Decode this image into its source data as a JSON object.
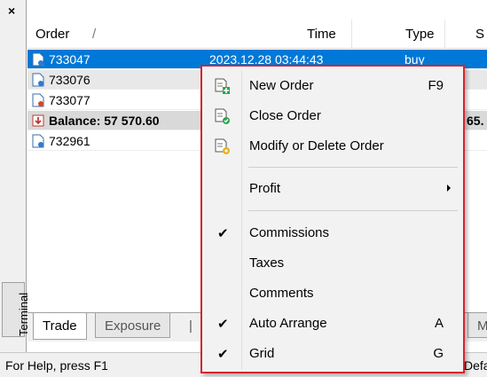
{
  "panel": {
    "close_glyph": "×",
    "vertical_label": "Terminal"
  },
  "table": {
    "columns": [
      "Order",
      "/",
      "Time",
      "Type",
      "S"
    ],
    "rows": [
      {
        "order": "733047",
        "time": "2023.12.28 03:44:43",
        "type": "buy",
        "state": "selected"
      },
      {
        "order": "733076",
        "time": "",
        "type": "",
        "state": "alt"
      },
      {
        "order": "733077",
        "time": "",
        "type": "",
        "state": "normal"
      },
      {
        "order": "Balance: 57 570.60",
        "time": "",
        "type": "65.",
        "state": "balance"
      },
      {
        "order": "732961",
        "time": "",
        "type": "",
        "state": "normal"
      }
    ]
  },
  "tabs": [
    "Trade",
    "Exposure",
    "|",
    "M"
  ],
  "status": {
    "help": "For Help, press F1",
    "right": "Defa"
  },
  "menu": {
    "items": [
      {
        "label": "New Order",
        "shortcut": "F9",
        "icon": "new-order-icon"
      },
      {
        "label": "Close Order",
        "shortcut": "",
        "icon": "close-order-icon"
      },
      {
        "label": "Modify or Delete Order",
        "shortcut": "",
        "icon": "modify-order-icon"
      },
      {
        "label": "Profit",
        "shortcut": "",
        "submenu": true
      },
      {
        "label": "Commissions",
        "checked": true
      },
      {
        "label": "Taxes",
        "checked": false
      },
      {
        "label": "Comments",
        "checked": false
      },
      {
        "label": "Auto Arrange",
        "shortcut": "A",
        "checked": true
      },
      {
        "label": "Grid",
        "shortcut": "G",
        "checked": true
      }
    ],
    "check_glyph": "✔"
  },
  "colors": {
    "selection": "#0078d7",
    "highlight_border": "#d9232c"
  }
}
